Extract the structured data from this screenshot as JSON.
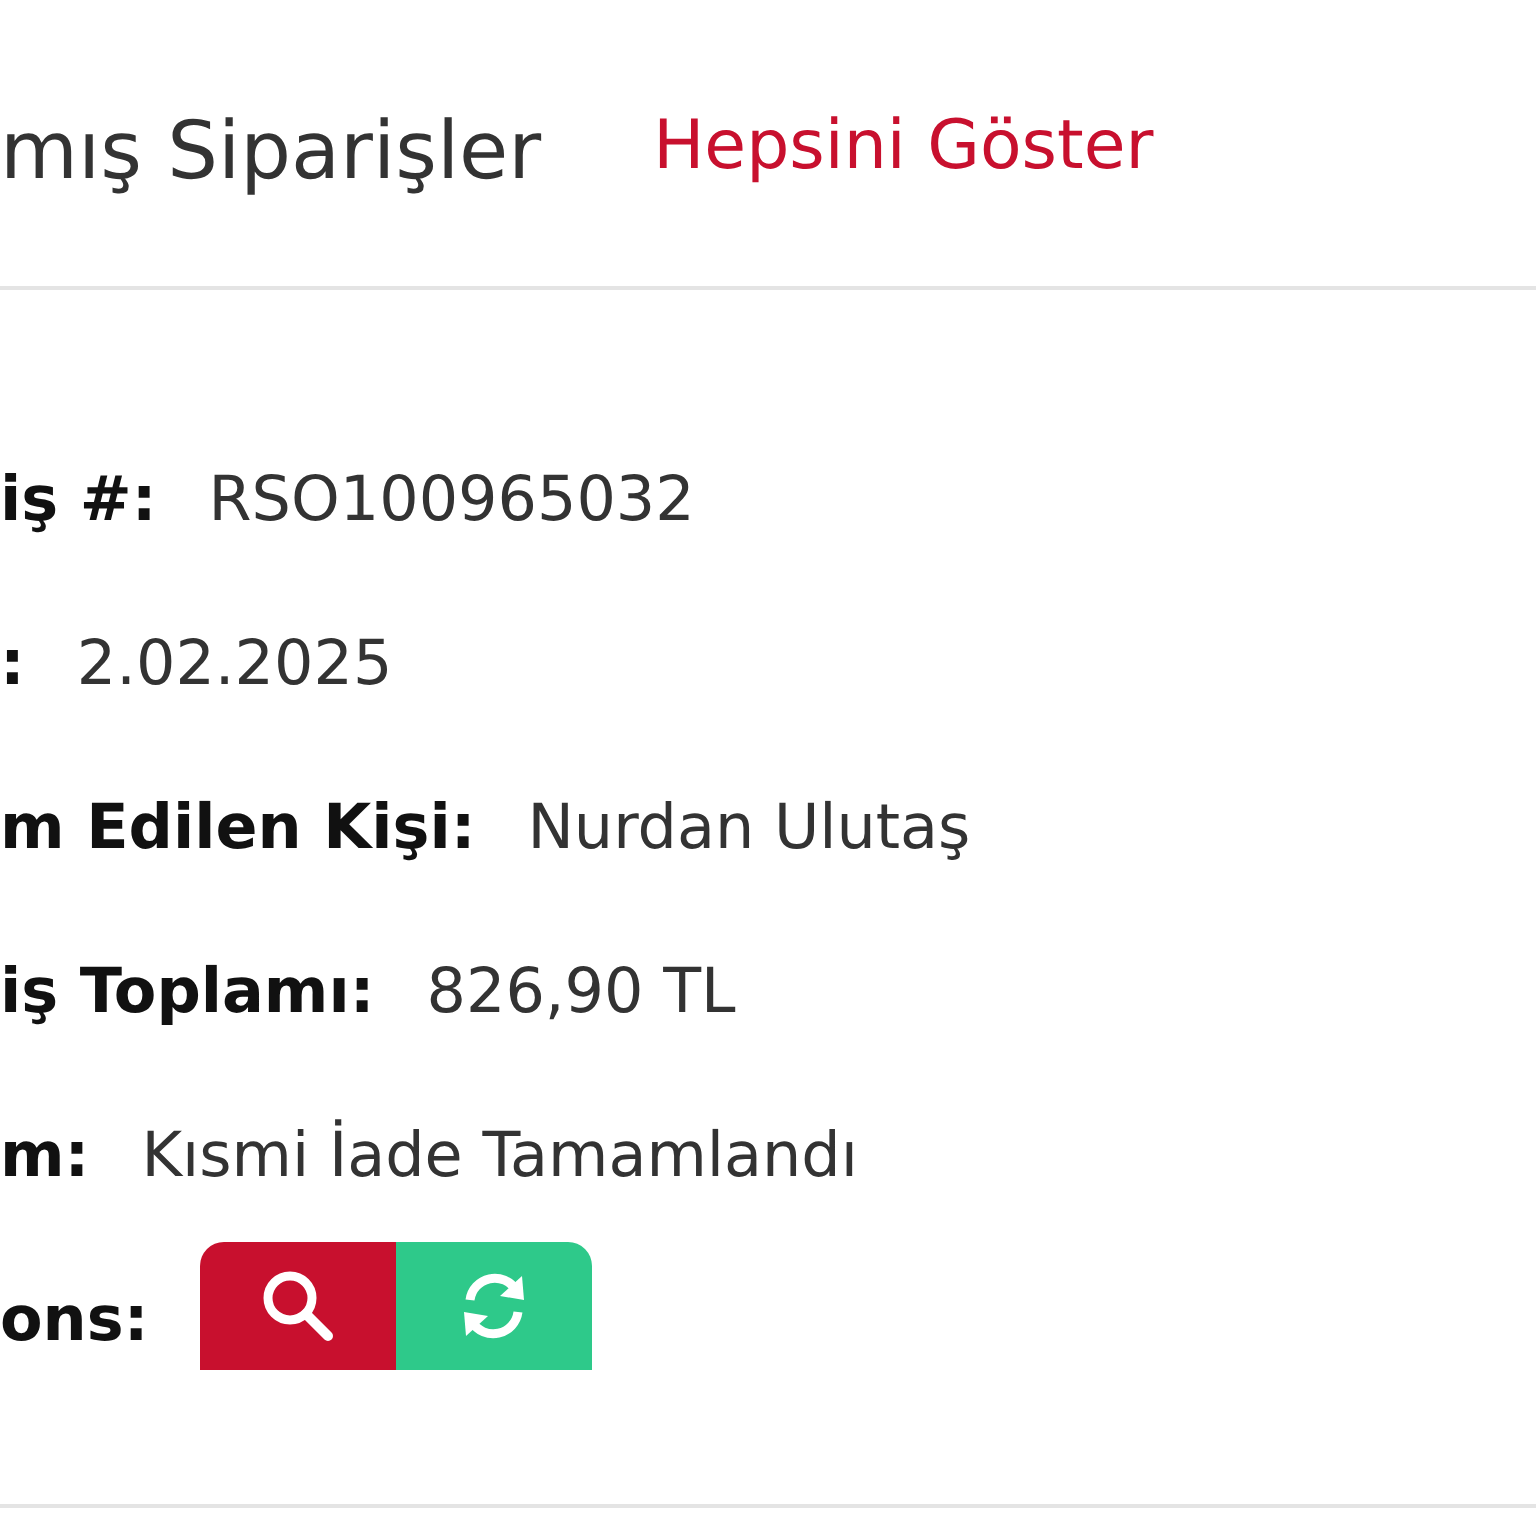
{
  "header": {
    "title": "mış Siparişler",
    "link": "Hepsini Göster"
  },
  "fields": [
    {
      "label": "iş #:",
      "value": "RSO100965032"
    },
    {
      "label": ":",
      "value": "2.02.2025"
    },
    {
      "label": "m Edilen Kişi:",
      "value": "Nurdan Ulutaş"
    },
    {
      "label": "iş Toplamı:",
      "value": "826,90 TL"
    },
    {
      "label": "m:",
      "value": "Kısmi İade Tamamlandı"
    }
  ],
  "actions": {
    "label": "ons:",
    "buttons": [
      {
        "kind": "search"
      },
      {
        "kind": "refresh"
      }
    ]
  }
}
